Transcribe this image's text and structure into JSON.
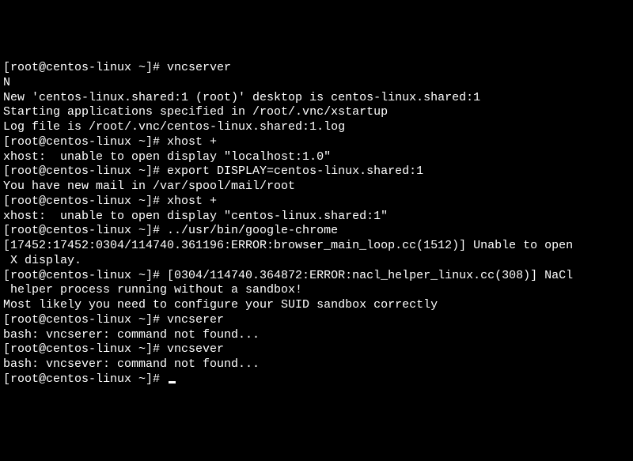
{
  "terminal": {
    "lines": [
      "[root@centos-linux ~]# vncserver",
      "N",
      "New 'centos-linux.shared:1 (root)' desktop is centos-linux.shared:1",
      "",
      "Starting applications specified in /root/.vnc/xstartup",
      "Log file is /root/.vnc/centos-linux.shared:1.log",
      "",
      "[root@centos-linux ~]# xhost +",
      "xhost:  unable to open display \"localhost:1.0\"",
      "[root@centos-linux ~]# export DISPLAY=centos-linux.shared:1",
      "You have new mail in /var/spool/mail/root",
      "[root@centos-linux ~]# xhost +",
      "xhost:  unable to open display \"centos-linux.shared:1\"",
      "[root@centos-linux ~]# ../usr/bin/google-chrome",
      "[17452:17452:0304/114740.361196:ERROR:browser_main_loop.cc(1512)] Unable to open",
      " X display.",
      "[root@centos-linux ~]# [0304/114740.364872:ERROR:nacl_helper_linux.cc(308)] NaCl",
      " helper process running without a sandbox!",
      "Most likely you need to configure your SUID sandbox correctly",
      "",
      "[root@centos-linux ~]# vncserer",
      "bash: vncserer: command not found...",
      "[root@centos-linux ~]# vncsever",
      "bash: vncsever: command not found...",
      "[root@centos-linux ~]# "
    ]
  }
}
